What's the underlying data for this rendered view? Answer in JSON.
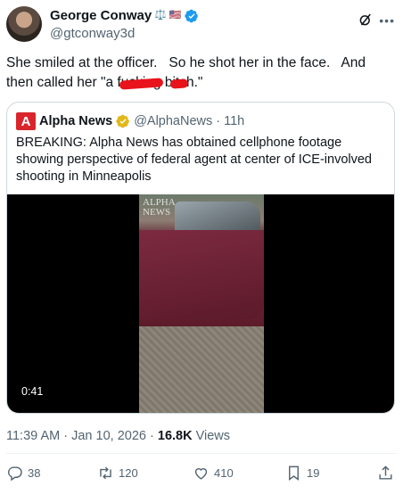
{
  "author": {
    "name": "George Conway",
    "handle": "@gtconway3d",
    "badges": [
      "⚖️",
      "🇺🇸"
    ]
  },
  "tweet": {
    "text_before": "She smiled at the officer.   So he shot her in the face.   And then called her \"a f",
    "redacted_1": "ucking",
    "text_mid": " b",
    "redacted_2": "itc",
    "text_after": "h.\""
  },
  "quote": {
    "logo": "A",
    "name": "Alpha News",
    "handle": "@AlphaNews",
    "separator": "·",
    "time": "11h",
    "text": "BREAKING: Alpha News has obtained cellphone footage showing perspective of federal agent at center of ICE-involved shooting in Minneapolis",
    "video": {
      "watermark_line1": "ALPHA",
      "watermark_line2": "NEWS",
      "duration": "0:41"
    }
  },
  "meta": {
    "time": "11:39 AM",
    "date": "Jan 10, 2026",
    "separator": "·",
    "views_count": "16.8K",
    "views_label": "Views"
  },
  "actions": {
    "replies": "38",
    "reposts": "120",
    "likes": "410",
    "bookmarks": "19"
  },
  "colors": {
    "accent": "#1d9bf0",
    "redaction": "#e8131b",
    "alpha_news_red": "#d9262c"
  }
}
